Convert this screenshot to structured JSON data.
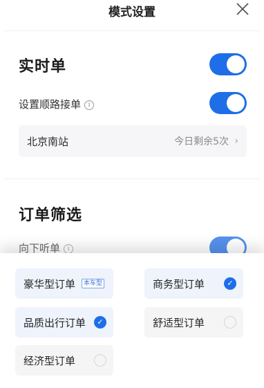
{
  "header": {
    "title": "模式设置",
    "close_icon": "close-icon"
  },
  "realtime": {
    "title": "实时单",
    "toggle_on": true,
    "route_label": "设置顺路接单",
    "route_toggle_on": true,
    "station": {
      "name": "北京南站",
      "remaining": "今日剩余5次"
    }
  },
  "filter": {
    "title": "订单筛选",
    "down_label": "向下听单",
    "down_toggle_on": true
  },
  "options": [
    {
      "label": "豪华型订单",
      "tag": "本车型",
      "selected": false
    },
    {
      "label": "商务型订单",
      "selected": true
    },
    {
      "label": "品质出行订单",
      "selected": true
    },
    {
      "label": "舒适型订单",
      "selected": false
    },
    {
      "label": "经济型订单",
      "selected": false
    }
  ],
  "colors": {
    "accent": "#1e6ee8"
  }
}
